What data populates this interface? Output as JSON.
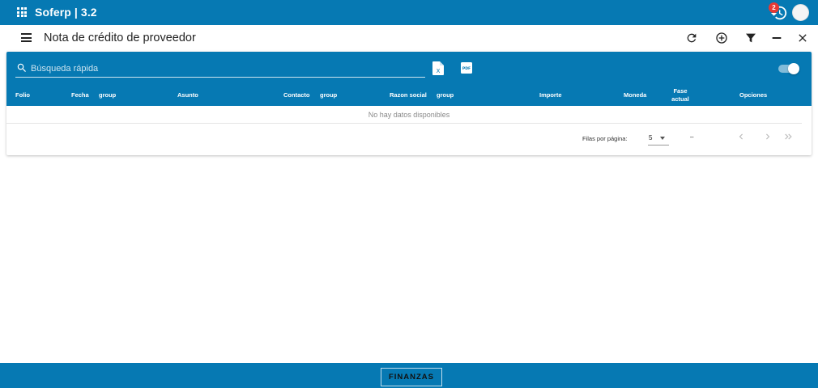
{
  "topbar": {
    "title": "Soferp | 3.2",
    "notifications_count": "2",
    "icons": [
      "apps-grid-icon",
      "history-icon",
      "avatar"
    ]
  },
  "header": {
    "title": "Nota de crédito de proveedor",
    "icons": [
      "refresh-icon",
      "add-circle-icon",
      "filter-icon",
      "minimize-icon",
      "close-icon"
    ]
  },
  "search": {
    "placeholder": "Búsqueda rápida",
    "value": ""
  },
  "toolbar": {
    "excel_icon_letter": "X",
    "pdf_label": "PDF",
    "toggle_on": true
  },
  "table": {
    "columns": [
      {
        "key": "folio",
        "label": "Folio"
      },
      {
        "key": "fecha",
        "label": "Fecha"
      },
      {
        "key": "group1",
        "label": "group"
      },
      {
        "key": "asunto",
        "label": "Asunto"
      },
      {
        "key": "contacto",
        "label": "Contacto"
      },
      {
        "key": "group2",
        "label": "group"
      },
      {
        "key": "razon_social",
        "label": "Razon social"
      },
      {
        "key": "group3",
        "label": "group"
      },
      {
        "key": "importe",
        "label": "Importe"
      },
      {
        "key": "moneda",
        "label": "Moneda"
      },
      {
        "key": "fase_actual_1",
        "label": "Fase"
      },
      {
        "key": "fase_actual_2",
        "label": "actual"
      },
      {
        "key": "opciones",
        "label": "Opciones"
      }
    ],
    "empty_message": "No hay datos disponibles",
    "rows": []
  },
  "pagination": {
    "rows_per_page_label": "Filas por página:",
    "rows_per_page_value": "5",
    "range_text": "–"
  },
  "bottombar": {
    "button_label": "FINANZAS"
  },
  "colors": {
    "primary": "#0679b3",
    "badge": "#e53935"
  }
}
